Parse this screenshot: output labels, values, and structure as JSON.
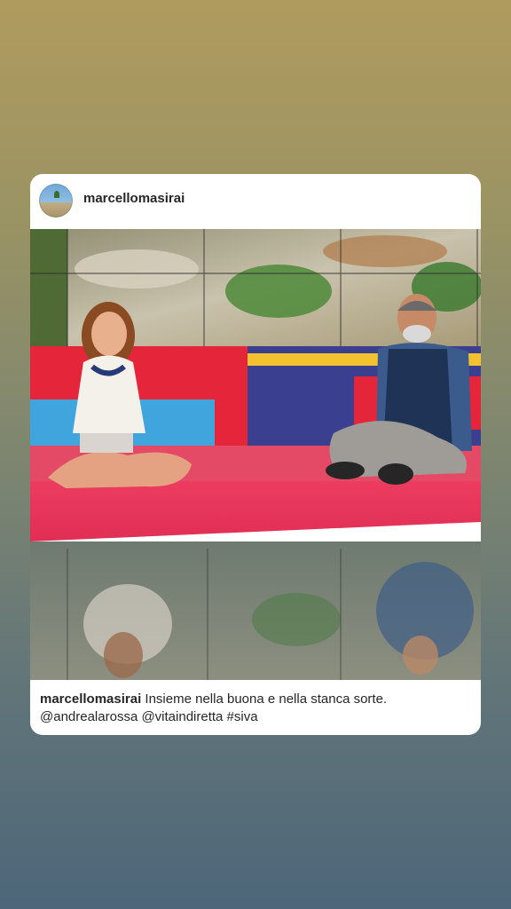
{
  "post": {
    "username": "marcellomasirai",
    "avatar_icon": "profile-photo-landscape",
    "photo_icon": "tv-studio-photo",
    "caption": {
      "username": "marcellomasirai",
      "text": "Insieme nella buona e nella stanca sorte.",
      "tags": "@andrealarossa @vitaindiretta #siva"
    }
  },
  "colors": {
    "card_background": "#ffffff",
    "text": "#262626",
    "studio_floor": "#e8385a",
    "studio_wall_red": "#e5263a",
    "studio_wall_blue": "#3a3f8f"
  }
}
